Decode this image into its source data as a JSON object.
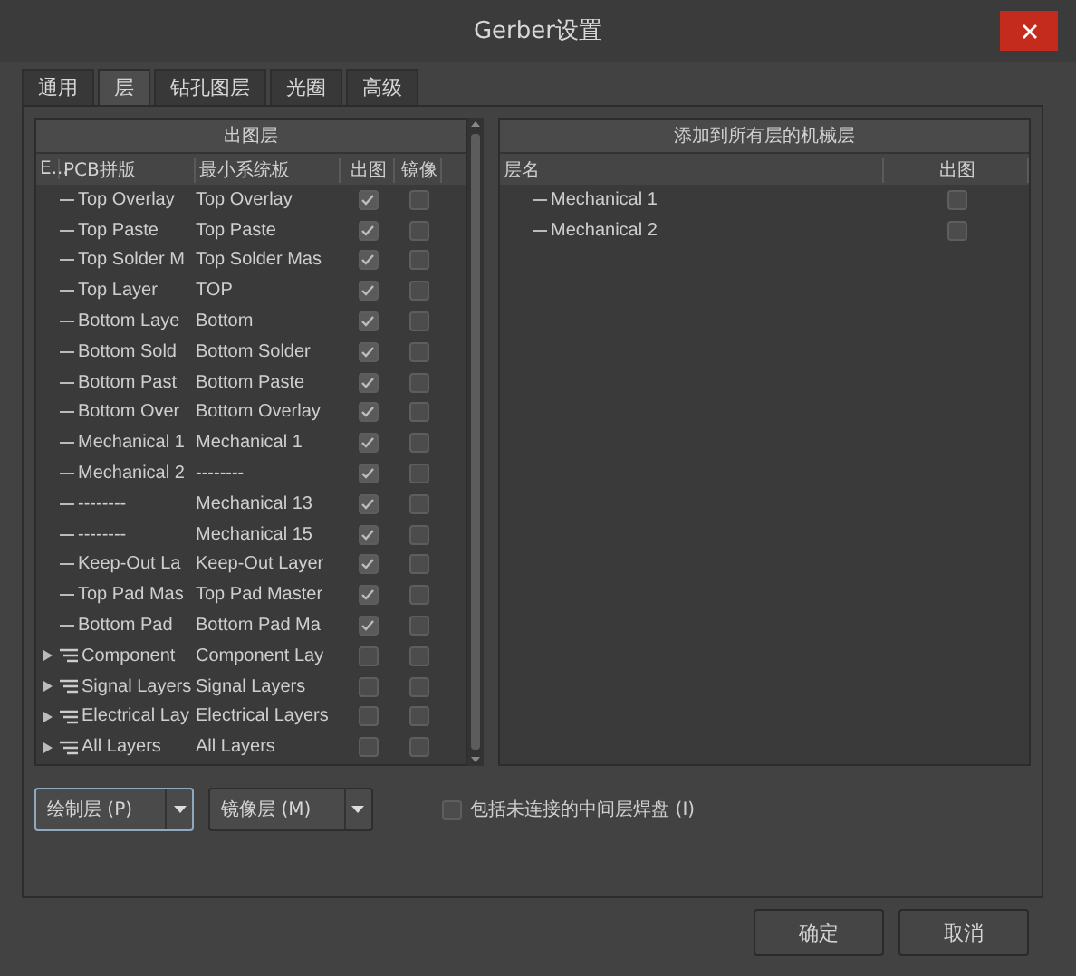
{
  "window": {
    "title": "Gerber设置"
  },
  "tabs": [
    {
      "label": "通用",
      "selected": false
    },
    {
      "label": "层",
      "selected": true
    },
    {
      "label": "钻孔图层",
      "selected": false
    },
    {
      "label": "光圈",
      "selected": false
    },
    {
      "label": "高级",
      "selected": false
    }
  ],
  "plot_layers": {
    "title": "出图层",
    "columns": [
      "E...",
      "PCB拼版",
      "最小系统板",
      "出图",
      "镜像"
    ],
    "rows": [
      {
        "kind": "layer",
        "name": "Top Overlay",
        "board": "Top Overlay",
        "plot": true,
        "mirror": false
      },
      {
        "kind": "layer",
        "name": "Top Paste",
        "board": "Top Paste",
        "plot": true,
        "mirror": false
      },
      {
        "kind": "layer",
        "name": "Top Solder M",
        "board": "Top Solder Mas",
        "plot": true,
        "mirror": false
      },
      {
        "kind": "layer",
        "name": "Top Layer",
        "board": "TOP",
        "plot": true,
        "mirror": false
      },
      {
        "kind": "layer",
        "name": "Bottom Laye",
        "board": "Bottom",
        "plot": true,
        "mirror": false
      },
      {
        "kind": "layer",
        "name": "Bottom Sold",
        "board": "Bottom Solder",
        "plot": true,
        "mirror": false
      },
      {
        "kind": "layer",
        "name": "Bottom Past",
        "board": "Bottom Paste",
        "plot": true,
        "mirror": false
      },
      {
        "kind": "layer",
        "name": "Bottom Over",
        "board": "Bottom Overlay",
        "plot": true,
        "mirror": false
      },
      {
        "kind": "layer",
        "name": "Mechanical 1",
        "board": "Mechanical 1",
        "plot": true,
        "mirror": false
      },
      {
        "kind": "layer",
        "name": "Mechanical 2",
        "board": "--------",
        "plot": true,
        "mirror": false
      },
      {
        "kind": "layer",
        "name": "--------",
        "board": "Mechanical 13",
        "plot": true,
        "mirror": false
      },
      {
        "kind": "layer",
        "name": "--------",
        "board": "Mechanical 15",
        "plot": true,
        "mirror": false
      },
      {
        "kind": "layer",
        "name": "Keep-Out La",
        "board": "Keep-Out Layer",
        "plot": true,
        "mirror": false
      },
      {
        "kind": "layer",
        "name": "Top Pad Mas",
        "board": "Top Pad Master",
        "plot": true,
        "mirror": false
      },
      {
        "kind": "layer",
        "name": "Bottom Pad",
        "board": "Bottom Pad Ma",
        "plot": true,
        "mirror": false
      },
      {
        "kind": "group",
        "name": "Component",
        "board": "Component Lay",
        "plot": false,
        "mirror": false
      },
      {
        "kind": "group",
        "name": "Signal Layers",
        "board": "Signal Layers",
        "plot": false,
        "mirror": false
      },
      {
        "kind": "group",
        "name": "Electrical Lay",
        "board": "Electrical Layers",
        "plot": false,
        "mirror": false
      },
      {
        "kind": "group",
        "name": "All Layers",
        "board": "All Layers",
        "plot": false,
        "mirror": false
      }
    ]
  },
  "mechanical": {
    "title": "添加到所有层的机械层",
    "columns": [
      "层名",
      "出图"
    ],
    "rows": [
      {
        "name": "Mechanical 1",
        "plot": false
      },
      {
        "name": "Mechanical 2",
        "plot": false
      }
    ]
  },
  "split_buttons": [
    {
      "label": "绘制层 (P)",
      "selected": true
    },
    {
      "label": "镜像层 (M)",
      "selected": false
    }
  ],
  "include_pads": {
    "label": "包括未连接的中间层焊盘 (I)",
    "checked": false
  },
  "buttons": [
    "确定",
    "取消"
  ]
}
